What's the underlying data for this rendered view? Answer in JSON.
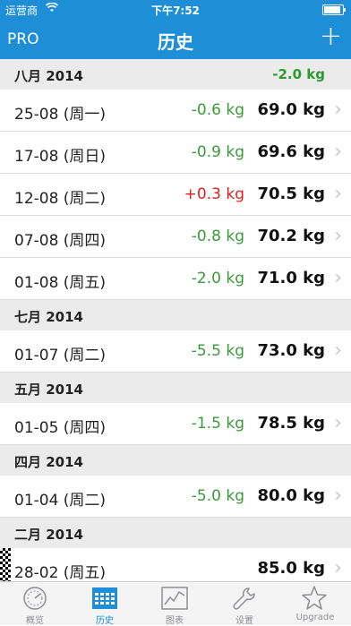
{
  "status": {
    "carrier": "运营商",
    "time": "下午7:52"
  },
  "navbar": {
    "pro": "PRO",
    "title": "历史",
    "add": "+"
  },
  "sections": [
    {
      "title": "八月 2014",
      "total": "-2.0 kg",
      "rows": [
        {
          "date": "25-08 (周一)",
          "change": "-0.6 kg",
          "trend": "loss",
          "weight": "69.0 kg"
        },
        {
          "date": "17-08 (周日)",
          "change": "-0.9 kg",
          "trend": "loss",
          "weight": "69.6 kg"
        },
        {
          "date": "12-08 (周二)",
          "change": "+0.3 kg",
          "trend": "gain",
          "weight": "70.5 kg"
        },
        {
          "date": "07-08 (周四)",
          "change": "-0.8 kg",
          "trend": "loss",
          "weight": "70.2 kg"
        },
        {
          "date": "01-08 (周五)",
          "change": "-2.0 kg",
          "trend": "loss",
          "weight": "71.0 kg"
        }
      ]
    },
    {
      "title": "七月 2014",
      "total": "",
      "rows": [
        {
          "date": "01-07 (周二)",
          "change": "-5.5 kg",
          "trend": "loss",
          "weight": "73.0 kg"
        }
      ]
    },
    {
      "title": "五月 2014",
      "total": "",
      "rows": [
        {
          "date": "01-05 (周四)",
          "change": "-1.5 kg",
          "trend": "loss",
          "weight": "78.5 kg"
        }
      ]
    },
    {
      "title": "四月 2014",
      "total": "",
      "rows": [
        {
          "date": "01-04 (周二)",
          "change": "-5.0 kg",
          "trend": "loss",
          "weight": "80.0 kg"
        }
      ]
    },
    {
      "title": "二月 2014",
      "total": "",
      "rows": [
        {
          "date": "28-02 (周五)",
          "change": "",
          "trend": "start",
          "weight": "85.0 kg"
        }
      ]
    }
  ],
  "tabbar": {
    "tabs": [
      {
        "label": "概览",
        "icon": "gauge-icon"
      },
      {
        "label": "历史",
        "icon": "calendar-icon"
      },
      {
        "label": "图表",
        "icon": "chart-icon"
      },
      {
        "label": "设置",
        "icon": "wrench-icon"
      },
      {
        "label": "Upgrade",
        "icon": "star-icon"
      }
    ],
    "active_index": 1
  },
  "colors": {
    "accent": "#1e8fd6",
    "loss": "#3b9a3b",
    "gain": "#e02020",
    "section_total": "#2c9a2c"
  }
}
